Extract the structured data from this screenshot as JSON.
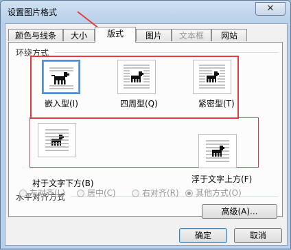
{
  "window": {
    "title": "设置图片格式",
    "close_glyph": "✕"
  },
  "tabs": [
    {
      "label": "颜色与线条",
      "state": "normal"
    },
    {
      "label": "大小",
      "state": "normal"
    },
    {
      "label": "版式",
      "state": "active"
    },
    {
      "label": "图片",
      "state": "normal"
    },
    {
      "label": "文本框",
      "state": "disabled"
    },
    {
      "label": "网站",
      "state": "normal"
    }
  ],
  "wrap_section": {
    "label": "环绕方式",
    "options": [
      {
        "label": "嵌入型(I)",
        "icon": "inline-with-text-icon",
        "selected": true
      },
      {
        "label": "四周型(Q)",
        "icon": "square-wrap-icon",
        "selected": false
      },
      {
        "label": "紧密型(T)",
        "icon": "tight-wrap-icon",
        "selected": false
      },
      {
        "label": "衬于文字下方(B)",
        "icon": "behind-text-icon",
        "selected": false
      },
      {
        "label": "浮于文字上方(F)",
        "icon": "in-front-of-text-icon",
        "selected": false
      }
    ]
  },
  "align_section": {
    "label": "水平对齐方式",
    "options": [
      {
        "label": "左对齐(L)",
        "checked": false
      },
      {
        "label": "居中(C)",
        "checked": false
      },
      {
        "label": "右对齐(R)",
        "checked": false
      },
      {
        "label": "其他方式(O)",
        "checked": true
      }
    ]
  },
  "buttons": {
    "advanced": "高级(A)...",
    "ok": "确定",
    "cancel": "取消"
  },
  "colors": {
    "annotation_red": "#e53b3b",
    "selection_blue": "#4f8fd6",
    "dialog_bg": "#f0f0f0"
  }
}
